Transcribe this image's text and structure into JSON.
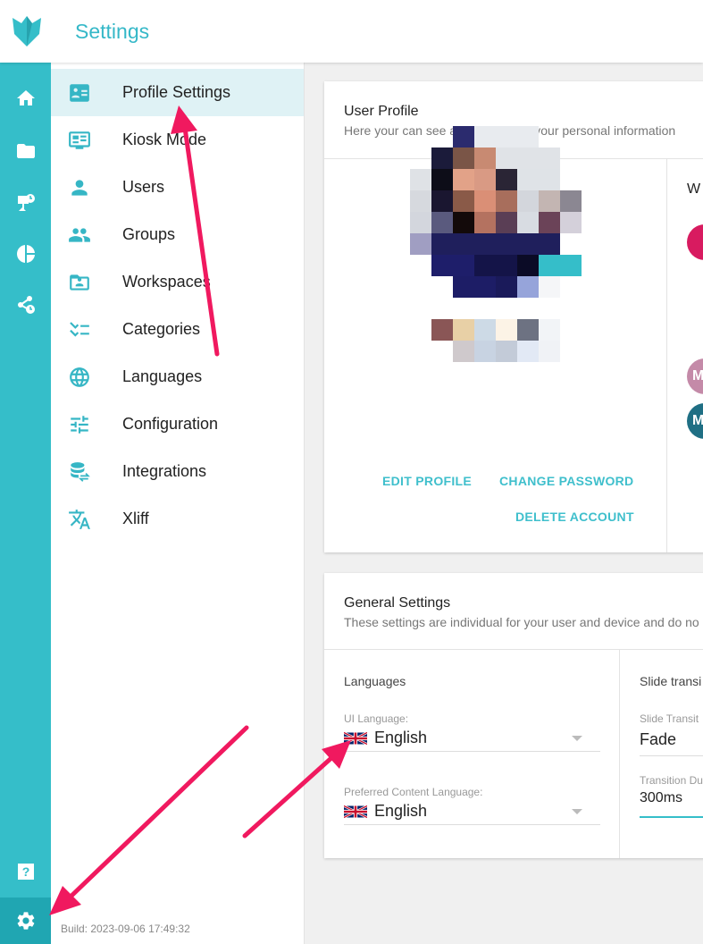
{
  "app": {
    "title": "Settings",
    "build": "Build: 2023-09-06 17:49:32"
  },
  "rail": {
    "items": [
      {
        "icon": "home-icon"
      },
      {
        "icon": "folder-icon"
      },
      {
        "icon": "presentation-icon"
      },
      {
        "icon": "pie-chart-icon"
      },
      {
        "icon": "share-schedule-icon"
      },
      {
        "icon": "help-icon"
      },
      {
        "icon": "gear-icon",
        "active": true
      }
    ]
  },
  "settings_nav": {
    "items": [
      {
        "label": "Profile Settings",
        "icon": "profile-card-icon",
        "active": true
      },
      {
        "label": "Kiosk Mode",
        "icon": "monitor-icon"
      },
      {
        "label": "Users",
        "icon": "user-icon"
      },
      {
        "label": "Groups",
        "icon": "group-icon"
      },
      {
        "label": "Workspaces",
        "icon": "workspace-folder-icon"
      },
      {
        "label": "Categories",
        "icon": "checklist-icon"
      },
      {
        "label": "Languages",
        "icon": "globe-icon"
      },
      {
        "label": "Configuration",
        "icon": "sliders-icon"
      },
      {
        "label": "Integrations",
        "icon": "database-sync-icon"
      },
      {
        "label": "Xliff",
        "icon": "translate-icon"
      }
    ]
  },
  "user_profile": {
    "title": "User Profile",
    "subtitle": "Here your can see and change all your personal information",
    "edit_profile": "EDIT PROFILE",
    "change_password": "CHANGE PASSWORD",
    "delete_account": "DELETE ACCOUNT",
    "workspaces_title_partial": "W",
    "mini_avatar_letters": [
      "M",
      "M"
    ]
  },
  "general_settings": {
    "title": "General Settings",
    "subtitle": "These settings are individual for your user and device and do no",
    "languages": {
      "section": "Languages",
      "ui_language_label": "UI Language:",
      "ui_language_value": "English",
      "content_language_label": "Preferred Content Language:",
      "content_language_value": "English"
    },
    "slide": {
      "section": "Slide transi",
      "transition_label": "Slide Transit",
      "transition_value": "Fade",
      "duration_label": "Transition Du",
      "duration_value": "300ms"
    }
  },
  "colors": {
    "accent": "#35bec9",
    "accent_dark": "#20a6b2",
    "active_nav_bg": "#dff2f5",
    "annotation_arrow": "#f0195f"
  }
}
